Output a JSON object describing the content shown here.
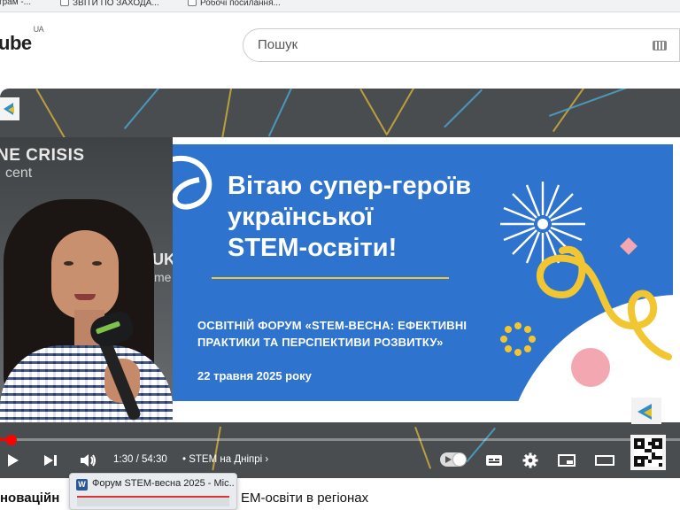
{
  "bookmarks": [
    {
      "label": "трам -..."
    },
    {
      "label": "ЗВІТИ ПО ЗАХОДА..."
    },
    {
      "label": "Робочі посилання..."
    }
  ],
  "header": {
    "logo_text": "ube",
    "region": "UA",
    "search_placeholder": "Пошук"
  },
  "video": {
    "speaker_backdrop": {
      "line1": "NE CRISIS",
      "line2": "cent",
      "line3": "UK",
      "line4": "me"
    },
    "slide": {
      "title_lines": [
        "Вітаю супер-героїв",
        "української",
        "STEM-освіти!"
      ],
      "subtitle": "ОСВІТНІЙ ФОРУМ «STEM-ВЕСНА: ЕФЕКТИВНІ ПРАКТИКИ ТА ПЕРСПЕКТИВИ РОЗВИТКУ»",
      "date": "22 травня 2025 року",
      "colors": {
        "blue": "#2e73cd",
        "yellow": "#f2c631",
        "pink": "#f3a7b0"
      }
    },
    "progress": 0.018
  },
  "controls": {
    "time": "1:30 / 54:30",
    "separator": "•",
    "chapter": "STEM на Дніпрі",
    "icons": [
      "play-icon",
      "next-icon",
      "volume-icon",
      "autoplay-toggle",
      "subtitles-icon",
      "settings-gear-icon",
      "miniplayer-icon",
      "theater-mode-icon"
    ]
  },
  "below": {
    "title_left": "новаційн",
    "title_right": "EM-освіти в регіонах"
  },
  "taskbar_preview": {
    "app_letter": "W",
    "title": "Форум STEM-весна 2025 - Міс..."
  }
}
